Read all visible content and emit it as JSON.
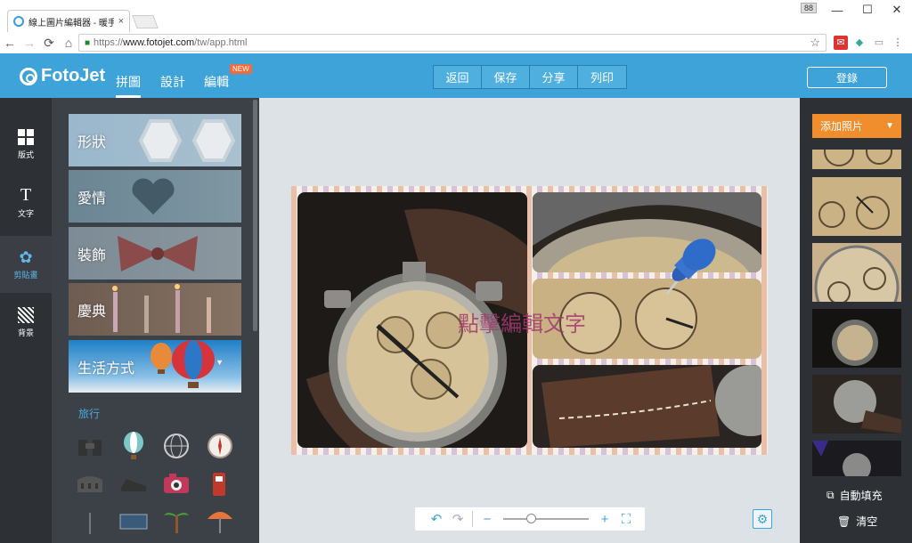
{
  "browser": {
    "tab_title": "線上圖片編輯器 - 暖手他",
    "tab_close": "×",
    "badge": "88",
    "url_scheme": "https://",
    "url_host": "www.fotojet.com",
    "url_path": "/tw/app.html",
    "window_controls": [
      "—",
      "☐",
      "✕"
    ]
  },
  "app": {
    "logo": "FotoJet",
    "nav": [
      {
        "label": "拼圖",
        "active": true
      },
      {
        "label": "設計",
        "active": false
      },
      {
        "label": "編輯",
        "active": false,
        "badge": "NEW"
      }
    ],
    "actions": [
      "返回",
      "保存",
      "分享",
      "列印"
    ],
    "login": "登錄"
  },
  "rail": [
    {
      "label": "版式",
      "icon": "layout-icon"
    },
    {
      "label": "文字",
      "icon": "text-icon"
    },
    {
      "label": "剪貼畫",
      "icon": "clipart-icon",
      "active": true
    },
    {
      "label": "背景",
      "icon": "background-icon"
    }
  ],
  "categories": [
    {
      "label": "形狀",
      "color": "#7fa8c5"
    },
    {
      "label": "愛情",
      "color": "#5f7d8e"
    },
    {
      "label": "裝飾",
      "color": "#6f7e8a"
    },
    {
      "label": "慶典",
      "color": "#6c6058"
    },
    {
      "label": "生活方式",
      "color": "#2f8ed1"
    }
  ],
  "clipart_section": "旅行",
  "clipart_icons": [
    "binoculars-icon",
    "hot-air-balloon-icon",
    "globe-icon",
    "compass-icon",
    "colosseum-icon",
    "shoes-icon",
    "camera-icon",
    "gas-pump-icon",
    "sign-icon",
    "ticket-icon",
    "palm-tree-icon",
    "beach-umbrella-icon"
  ],
  "canvas": {
    "edit_text": "點擊編輯文字"
  },
  "right": {
    "add_photo": "添加照片",
    "auto_fill": "自動填充",
    "clear": "清空"
  }
}
